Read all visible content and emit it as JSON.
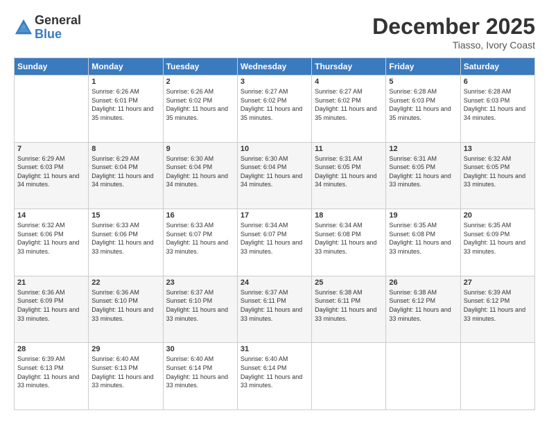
{
  "logo": {
    "general": "General",
    "blue": "Blue"
  },
  "title": {
    "month_year": "December 2025",
    "location": "Tiasso, Ivory Coast"
  },
  "header_days": [
    "Sunday",
    "Monday",
    "Tuesday",
    "Wednesday",
    "Thursday",
    "Friday",
    "Saturday"
  ],
  "weeks": [
    [
      {
        "day": "",
        "sunrise": "",
        "sunset": "",
        "daylight": ""
      },
      {
        "day": "1",
        "sunrise": "Sunrise: 6:26 AM",
        "sunset": "Sunset: 6:01 PM",
        "daylight": "Daylight: 11 hours and 35 minutes."
      },
      {
        "day": "2",
        "sunrise": "Sunrise: 6:26 AM",
        "sunset": "Sunset: 6:02 PM",
        "daylight": "Daylight: 11 hours and 35 minutes."
      },
      {
        "day": "3",
        "sunrise": "Sunrise: 6:27 AM",
        "sunset": "Sunset: 6:02 PM",
        "daylight": "Daylight: 11 hours and 35 minutes."
      },
      {
        "day": "4",
        "sunrise": "Sunrise: 6:27 AM",
        "sunset": "Sunset: 6:02 PM",
        "daylight": "Daylight: 11 hours and 35 minutes."
      },
      {
        "day": "5",
        "sunrise": "Sunrise: 6:28 AM",
        "sunset": "Sunset: 6:03 PM",
        "daylight": "Daylight: 11 hours and 35 minutes."
      },
      {
        "day": "6",
        "sunrise": "Sunrise: 6:28 AM",
        "sunset": "Sunset: 6:03 PM",
        "daylight": "Daylight: 11 hours and 34 minutes."
      }
    ],
    [
      {
        "day": "7",
        "sunrise": "Sunrise: 6:29 AM",
        "sunset": "Sunset: 6:03 PM",
        "daylight": "Daylight: 11 hours and 34 minutes."
      },
      {
        "day": "8",
        "sunrise": "Sunrise: 6:29 AM",
        "sunset": "Sunset: 6:04 PM",
        "daylight": "Daylight: 11 hours and 34 minutes."
      },
      {
        "day": "9",
        "sunrise": "Sunrise: 6:30 AM",
        "sunset": "Sunset: 6:04 PM",
        "daylight": "Daylight: 11 hours and 34 minutes."
      },
      {
        "day": "10",
        "sunrise": "Sunrise: 6:30 AM",
        "sunset": "Sunset: 6:04 PM",
        "daylight": "Daylight: 11 hours and 34 minutes."
      },
      {
        "day": "11",
        "sunrise": "Sunrise: 6:31 AM",
        "sunset": "Sunset: 6:05 PM",
        "daylight": "Daylight: 11 hours and 34 minutes."
      },
      {
        "day": "12",
        "sunrise": "Sunrise: 6:31 AM",
        "sunset": "Sunset: 6:05 PM",
        "daylight": "Daylight: 11 hours and 33 minutes."
      },
      {
        "day": "13",
        "sunrise": "Sunrise: 6:32 AM",
        "sunset": "Sunset: 6:05 PM",
        "daylight": "Daylight: 11 hours and 33 minutes."
      }
    ],
    [
      {
        "day": "14",
        "sunrise": "Sunrise: 6:32 AM",
        "sunset": "Sunset: 6:06 PM",
        "daylight": "Daylight: 11 hours and 33 minutes."
      },
      {
        "day": "15",
        "sunrise": "Sunrise: 6:33 AM",
        "sunset": "Sunset: 6:06 PM",
        "daylight": "Daylight: 11 hours and 33 minutes."
      },
      {
        "day": "16",
        "sunrise": "Sunrise: 6:33 AM",
        "sunset": "Sunset: 6:07 PM",
        "daylight": "Daylight: 11 hours and 33 minutes."
      },
      {
        "day": "17",
        "sunrise": "Sunrise: 6:34 AM",
        "sunset": "Sunset: 6:07 PM",
        "daylight": "Daylight: 11 hours and 33 minutes."
      },
      {
        "day": "18",
        "sunrise": "Sunrise: 6:34 AM",
        "sunset": "Sunset: 6:08 PM",
        "daylight": "Daylight: 11 hours and 33 minutes."
      },
      {
        "day": "19",
        "sunrise": "Sunrise: 6:35 AM",
        "sunset": "Sunset: 6:08 PM",
        "daylight": "Daylight: 11 hours and 33 minutes."
      },
      {
        "day": "20",
        "sunrise": "Sunrise: 6:35 AM",
        "sunset": "Sunset: 6:09 PM",
        "daylight": "Daylight: 11 hours and 33 minutes."
      }
    ],
    [
      {
        "day": "21",
        "sunrise": "Sunrise: 6:36 AM",
        "sunset": "Sunset: 6:09 PM",
        "daylight": "Daylight: 11 hours and 33 minutes."
      },
      {
        "day": "22",
        "sunrise": "Sunrise: 6:36 AM",
        "sunset": "Sunset: 6:10 PM",
        "daylight": "Daylight: 11 hours and 33 minutes."
      },
      {
        "day": "23",
        "sunrise": "Sunrise: 6:37 AM",
        "sunset": "Sunset: 6:10 PM",
        "daylight": "Daylight: 11 hours and 33 minutes."
      },
      {
        "day": "24",
        "sunrise": "Sunrise: 6:37 AM",
        "sunset": "Sunset: 6:11 PM",
        "daylight": "Daylight: 11 hours and 33 minutes."
      },
      {
        "day": "25",
        "sunrise": "Sunrise: 6:38 AM",
        "sunset": "Sunset: 6:11 PM",
        "daylight": "Daylight: 11 hours and 33 minutes."
      },
      {
        "day": "26",
        "sunrise": "Sunrise: 6:38 AM",
        "sunset": "Sunset: 6:12 PM",
        "daylight": "Daylight: 11 hours and 33 minutes."
      },
      {
        "day": "27",
        "sunrise": "Sunrise: 6:39 AM",
        "sunset": "Sunset: 6:12 PM",
        "daylight": "Daylight: 11 hours and 33 minutes."
      }
    ],
    [
      {
        "day": "28",
        "sunrise": "Sunrise: 6:39 AM",
        "sunset": "Sunset: 6:13 PM",
        "daylight": "Daylight: 11 hours and 33 minutes."
      },
      {
        "day": "29",
        "sunrise": "Sunrise: 6:40 AM",
        "sunset": "Sunset: 6:13 PM",
        "daylight": "Daylight: 11 hours and 33 minutes."
      },
      {
        "day": "30",
        "sunrise": "Sunrise: 6:40 AM",
        "sunset": "Sunset: 6:14 PM",
        "daylight": "Daylight: 11 hours and 33 minutes."
      },
      {
        "day": "31",
        "sunrise": "Sunrise: 6:40 AM",
        "sunset": "Sunset: 6:14 PM",
        "daylight": "Daylight: 11 hours and 33 minutes."
      },
      {
        "day": "",
        "sunrise": "",
        "sunset": "",
        "daylight": ""
      },
      {
        "day": "",
        "sunrise": "",
        "sunset": "",
        "daylight": ""
      },
      {
        "day": "",
        "sunrise": "",
        "sunset": "",
        "daylight": ""
      }
    ]
  ]
}
